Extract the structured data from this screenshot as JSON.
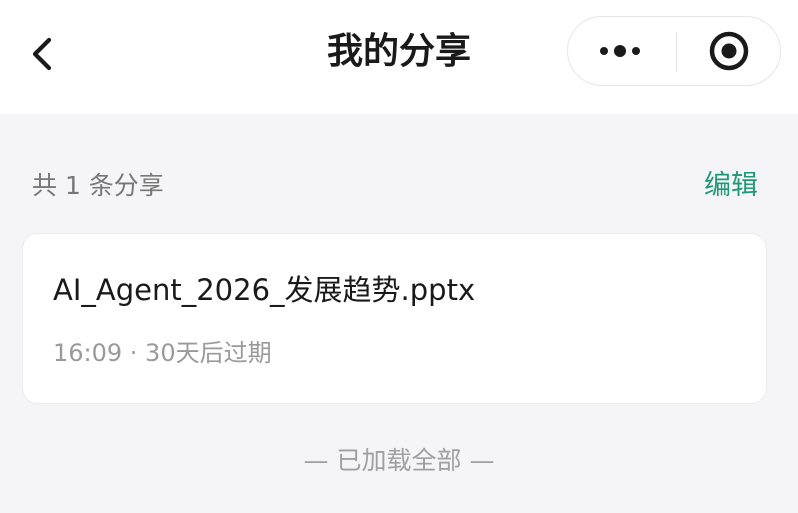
{
  "header": {
    "title": "我的分享",
    "back_icon": "chevron-left-icon",
    "more_icon": "more-dots-icon",
    "close_icon": "target-close-icon"
  },
  "summary": {
    "count_text": "共 1 条分享",
    "edit_label": "编辑"
  },
  "shares": [
    {
      "file_name": "AI_Agent_2026_发展趋势.pptx",
      "meta": "16:09 · 30天后过期"
    }
  ],
  "footer": {
    "load_end_text": "— 已加载全部 —"
  },
  "colors": {
    "accent": "#1e9a78",
    "background": "#f5f5f7",
    "card": "#ffffff",
    "title": "#1a1a1a",
    "secondary": "#9a9a9a"
  }
}
